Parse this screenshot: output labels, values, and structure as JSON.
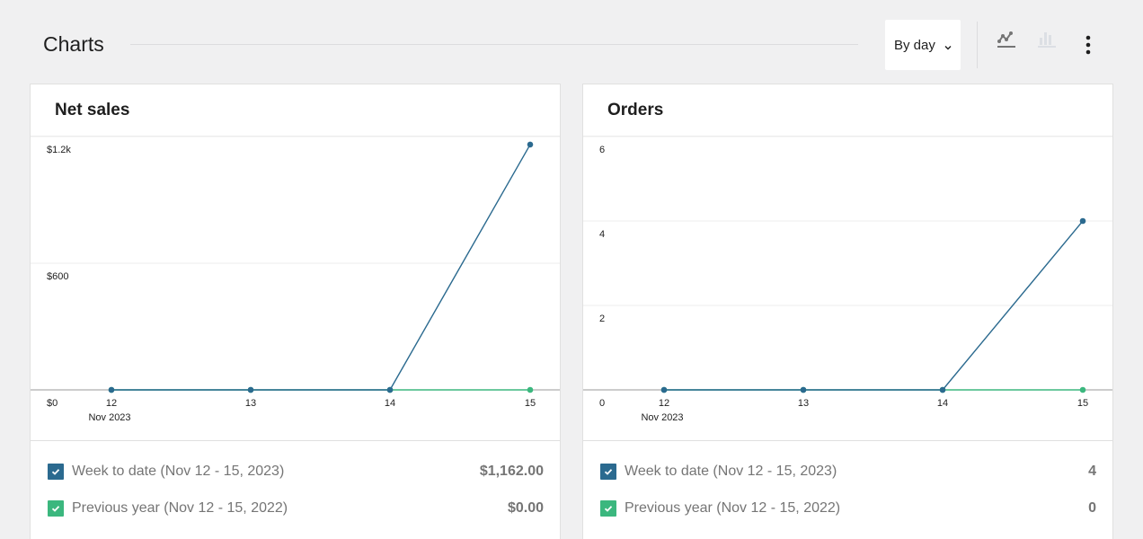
{
  "header": {
    "title": "Charts",
    "interval_select": {
      "value": "By day"
    },
    "icons": {
      "line_chart": "line-chart-icon",
      "bar_chart": "bar-chart-icon",
      "more": "more-vertical-icon"
    },
    "active_chart_type": "line"
  },
  "colors": {
    "current": "#2b6a8f",
    "previous": "#3bb77e",
    "axis": "#9a9a9a",
    "grid": "#ececec",
    "icon_active": "#757575",
    "icon_inactive": "#dcdfe4"
  },
  "cards": [
    {
      "title": "Net sales",
      "legend": [
        {
          "label": "Week to date (Nov 12 - 15, 2023)",
          "value": "$1,162.00",
          "color": "#2b6a8f",
          "checked": true
        },
        {
          "label": "Previous year (Nov 12 - 15, 2022)",
          "value": "$0.00",
          "color": "#3bb77e",
          "checked": true
        }
      ]
    },
    {
      "title": "Orders",
      "legend": [
        {
          "label": "Week to date (Nov 12 - 15, 2023)",
          "value": "4",
          "color": "#2b6a8f",
          "checked": true
        },
        {
          "label": "Previous year (Nov 12 - 15, 2022)",
          "value": "0",
          "color": "#3bb77e",
          "checked": true
        }
      ]
    }
  ],
  "chart_data": [
    {
      "type": "line",
      "title": "Net sales",
      "x": [
        "12",
        "13",
        "14",
        "15"
      ],
      "x_sublabel": "Nov 2023",
      "ylim": [
        0,
        1200
      ],
      "yticks": [
        0,
        600,
        1200
      ],
      "ytick_labels": [
        "$0",
        "$600",
        "$1.2k"
      ],
      "grid": true,
      "series": [
        {
          "name": "Previous year (Nov 12 - 15, 2022)",
          "values": [
            0,
            0,
            0,
            0
          ],
          "color": "#3bb77e"
        },
        {
          "name": "Week to date (Nov 12 - 15, 2023)",
          "values": [
            0,
            0,
            0,
            1162
          ],
          "color": "#2b6a8f"
        }
      ]
    },
    {
      "type": "line",
      "title": "Orders",
      "x": [
        "12",
        "13",
        "14",
        "15"
      ],
      "x_sublabel": "Nov 2023",
      "ylim": [
        0,
        6
      ],
      "yticks": [
        0,
        2,
        4,
        6
      ],
      "ytick_labels": [
        "0",
        "2",
        "4",
        "6"
      ],
      "grid": true,
      "series": [
        {
          "name": "Previous year (Nov 12 - 15, 2022)",
          "values": [
            0,
            0,
            0,
            0
          ],
          "color": "#3bb77e"
        },
        {
          "name": "Week to date (Nov 12 - 15, 2023)",
          "values": [
            0,
            0,
            0,
            4
          ],
          "color": "#2b6a8f"
        }
      ]
    }
  ]
}
